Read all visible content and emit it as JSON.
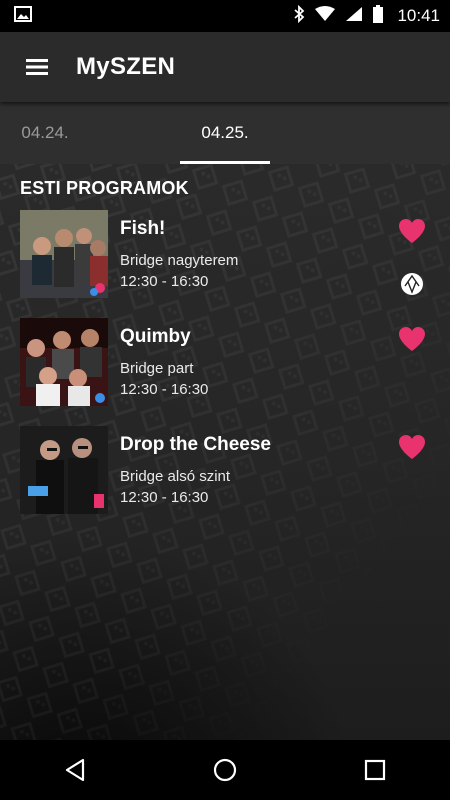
{
  "status_bar": {
    "time": "10:41",
    "icons": [
      "image-icon",
      "bluetooth-icon",
      "wifi-icon",
      "signal-icon",
      "battery-icon"
    ]
  },
  "app_bar": {
    "title": "MySZEN",
    "menu_icon": "hamburger-menu-icon"
  },
  "tabs": [
    {
      "label": "04.24.",
      "active": false
    },
    {
      "label": "04.25.",
      "active": true
    }
  ],
  "section_title": "ESTI PROGRAMOK",
  "events": [
    {
      "name": "Fish!",
      "venue": "Bridge nagyterem",
      "time": "12:30 - 16:30",
      "favorite": true,
      "sponsor_icon": true
    },
    {
      "name": "Quimby",
      "venue": "Bridge part",
      "time": "12:30 - 16:30",
      "favorite": true,
      "sponsor_icon": false
    },
    {
      "name": "Drop the Cheese",
      "venue": "Bridge alsó szint",
      "time": "12:30 - 16:30",
      "favorite": true,
      "sponsor_icon": false
    }
  ],
  "colors": {
    "accent_heart": "#e8336f",
    "app_bar": "#2b2b2b",
    "tab_bar": "#2f2f2f"
  },
  "nav_bar": {
    "buttons": [
      "back-icon",
      "home-icon",
      "recents-icon"
    ]
  }
}
